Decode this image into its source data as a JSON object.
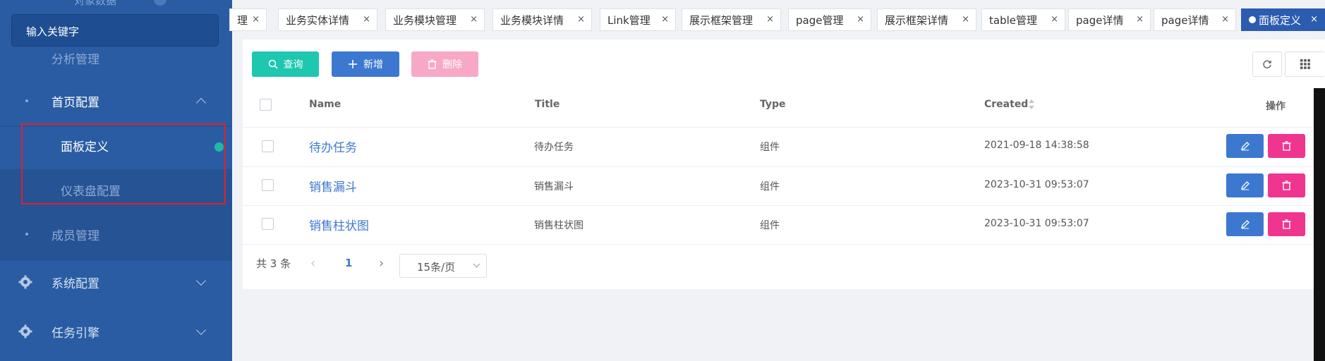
{
  "sidebar": {
    "top_fragment": "对象数据",
    "search_placeholder": "输入关键字",
    "partial_item": "分析管理",
    "items": [
      {
        "label": "首页配置",
        "icon": "dot",
        "expanded": true
      },
      {
        "label": "面板定义",
        "active": true
      },
      {
        "label": "仪表盘配置"
      },
      {
        "label": "成员管理",
        "icon": "dot"
      },
      {
        "label": "系统配置",
        "icon": "gear-icon",
        "expanded": false
      },
      {
        "label": "任务引擎",
        "icon": "gear-icon",
        "expanded": false
      }
    ]
  },
  "tabs": [
    {
      "label": "理"
    },
    {
      "label": "业务实体详情"
    },
    {
      "label": "业务模块管理"
    },
    {
      "label": "业务模块详情"
    },
    {
      "label": "Link管理"
    },
    {
      "label": "展示框架管理"
    },
    {
      "label": "page管理"
    },
    {
      "label": "展示框架详情"
    },
    {
      "label": "table管理"
    },
    {
      "label": "page详情"
    },
    {
      "label": "page详情"
    },
    {
      "label": "面板定义",
      "active": true
    }
  ],
  "toolbar": {
    "query_label": "查询",
    "add_label": "新增",
    "delete_label": "删除"
  },
  "table": {
    "headers": {
      "name": "Name",
      "title": "Title",
      "type": "Type",
      "created": "Created",
      "actions": "操作"
    },
    "rows": [
      {
        "name": "待办任务",
        "title": "待办任务",
        "type": "组件",
        "created": "2021-09-18 14:38:58"
      },
      {
        "name": "销售漏斗",
        "title": "销售漏斗",
        "type": "组件",
        "created": "2023-10-31 09:53:07"
      },
      {
        "name": "销售柱状图",
        "title": "销售柱状图",
        "type": "组件",
        "created": "2023-10-31 09:53:07"
      }
    ]
  },
  "pagination": {
    "total": "共 3 条",
    "current_page": "1",
    "page_size": "15条/页"
  },
  "colors": {
    "sidebar_bg": "#2a5ca3",
    "primary": "#3d78d0",
    "teal": "#1ec7b0",
    "danger": "#f0358f",
    "highlight_border": "#e0202f"
  }
}
